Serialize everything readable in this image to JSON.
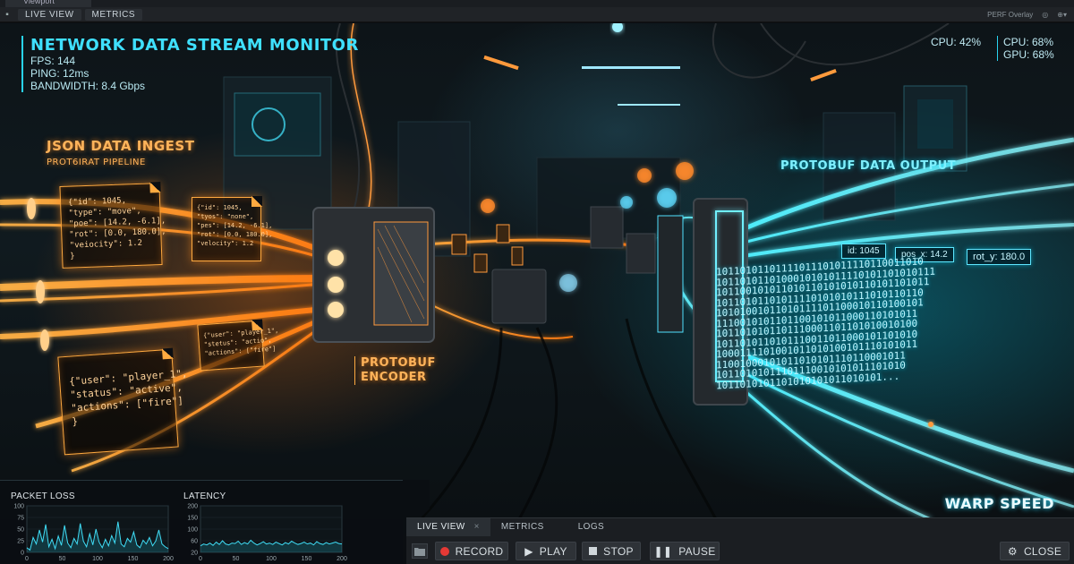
{
  "window": {
    "tab_title": "Viewport"
  },
  "toolbar": {
    "tabs": [
      "LIVE VIEW",
      "METRICS"
    ],
    "right_label": "PERF Overlay"
  },
  "hud": {
    "title": "NETWORK DATA STREAM MONITOR",
    "fps": "FPS: 144",
    "ping": "PING: 12ms",
    "bandwidth": "BANDWIDTH: 8.4 Gbps",
    "cpu_left": "CPU: 42%",
    "cpu_right": "CPU: 68%",
    "gpu_right": "GPU: 68%"
  },
  "scene": {
    "ingest_title": "JSON DATA INGEST",
    "ingest_sub": "PROT6IRAT PIPELINE",
    "card1": "{\"id\": 1045,\n\"type\": \"move\",\n\"poe\": [14.2, -6.1],\n\"rot\": [0.0, 180.0],\n\"veiocity\": 1.2\n}",
    "card2": "{\"id\": 1045,\n\"tyos\": \"none\",\n\"pes\": [14.2, -6.1],\n\"rot\": [0.0, 180.0],\n\"velocity\": 1.2",
    "card3": "{\"user\": \"player_1\",\n\"status\": \"active\",\n\"actions\": [\"fire\"]\n}",
    "card4": "{\"user\": \"player_1\",\n\"stetus\": \"actio\",\n\"actions\": [\"fire\"]",
    "encoder_line1": "PROTOBUF",
    "encoder_line2": "ENCODER",
    "output_title": "PROTOBUF DATA OUTPUT",
    "tag_id": "id: 1045",
    "tag_pos": "pos_x: 14.2",
    "tag_rot": "rot_y: 180.0",
    "binary": "10110101101111011101011110110011010\n1011010110100010101011110101101010111\n101100101011010110101010110101101011\n10110101101011110101010111010110110\n10101001011010111101100010110100101\n1110010101101100101011000110101011\n1011010101101110001101101010010100\n1011010110101110011011000101101010\n1000111101001011010100101110101011\n11001000101011010101110110001011\n10110101011101110010101011101010\n1011010101101010101011010101...",
    "warp": "WARP SPEED"
  },
  "graphs": {
    "packet_loss": {
      "title": "PACKET LOSS",
      "y_ticks": [
        "100",
        "75",
        "50",
        "25",
        "0"
      ],
      "x_ticks": [
        "0",
        "50",
        "100",
        "150",
        "200"
      ],
      "values": [
        10,
        5,
        32,
        18,
        48,
        22,
        60,
        12,
        28,
        8,
        35,
        15,
        58,
        20,
        10,
        30,
        18,
        62,
        24,
        12,
        40,
        16,
        50,
        22,
        10,
        28,
        14,
        36,
        20,
        66,
        18,
        12,
        30,
        22,
        44,
        16,
        10,
        26,
        18,
        32,
        14,
        24,
        48,
        18,
        12,
        8
      ]
    },
    "latency": {
      "title": "LATENCY",
      "y_ticks": [
        "200",
        "150",
        "100",
        "60",
        "20"
      ],
      "x_ticks": [
        "0",
        "50",
        "100",
        "150",
        "200"
      ],
      "values": [
        14,
        18,
        16,
        20,
        15,
        22,
        17,
        25,
        18,
        16,
        20,
        19,
        24,
        17,
        21,
        18,
        26,
        20,
        16,
        19,
        23,
        18,
        20,
        17,
        22,
        19,
        16,
        21,
        18,
        24,
        20,
        17,
        19,
        22,
        18,
        20,
        16,
        23,
        19,
        17,
        21,
        18,
        20,
        22,
        19,
        18
      ]
    }
  },
  "controls": {
    "tabs": [
      "LIVE VIEW",
      "METRICS",
      "LOGS"
    ],
    "record": "RECORD",
    "play": "PLAY",
    "stop": "STOP",
    "pause": "PAUSE",
    "close": "CLOSE"
  },
  "colors": {
    "cyan": "#29d3f0",
    "orange": "#ffaa40",
    "record_red": "#e53935"
  }
}
